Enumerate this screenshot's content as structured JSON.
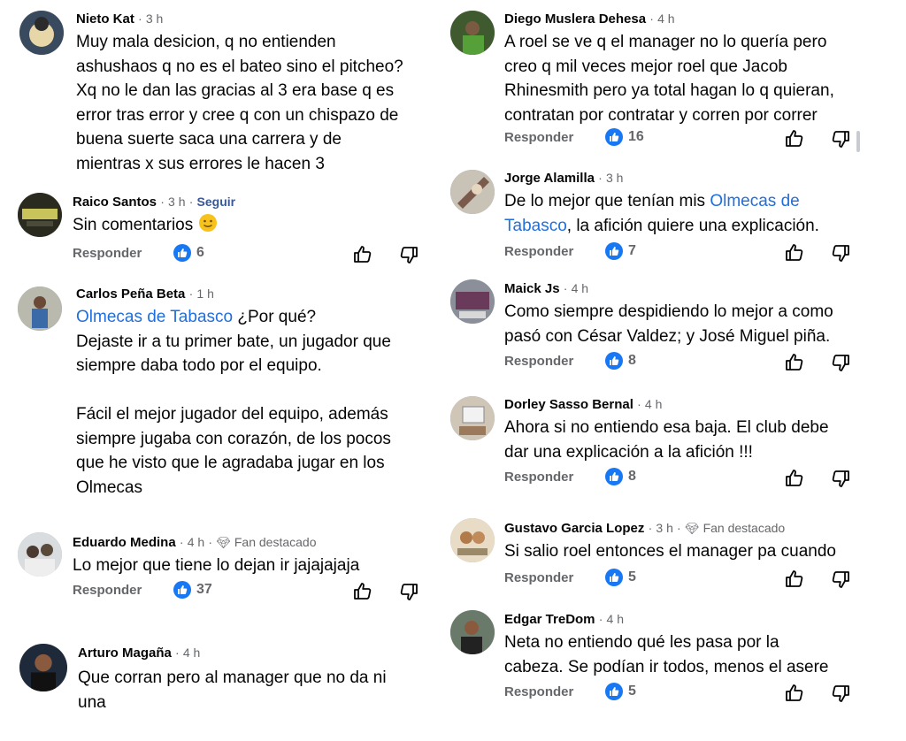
{
  "ui": {
    "reply_label": "Responder",
    "follow_label": "Seguir",
    "fan_label": "Fan destacado",
    "separator": "·"
  },
  "comments_left": [
    {
      "author": "Nieto Kat",
      "time": "3 h",
      "text": "Muy mala desicion, q no entienden\nashushaos q no es el bateo sino el pitcheo?\nXq no le dan las gracias al 3 era base q es\nerror tras error y cree q con un chispazo de\nbuena suerte saca una carrera y de\nmientras x sus errores le hacen 3"
    },
    {
      "author": "Raico Santos",
      "time": "3 h",
      "text": "Sin comentarios",
      "emoji": "slightly-smiling-face",
      "likes": "6"
    },
    {
      "author": "Carlos Peña Beta",
      "time": "1 h",
      "mention": "Olmecas de Tabasco",
      "text_after_mention": " ¿Por qué?",
      "text": "Dejaste ir a tu primer bate, un jugador que\nsiempre daba todo por el equipo.\n\nFácil el mejor jugador del equipo, además\nsiempre jugaba con corazón, de los pocos\nque he visto que le agradaba jugar en los\nOlmecas"
    },
    {
      "author": "Eduardo Medina",
      "time": "4 h",
      "text": "Lo mejor que tiene lo dejan ir jajajajaja",
      "likes": "37"
    },
    {
      "author": "Arturo Magaña",
      "time": "4 h",
      "text": "Que corran pero al manager que no da ni\nuna"
    }
  ],
  "comments_right": [
    {
      "author": "Diego Muslera Dehesa",
      "time": "4 h",
      "text": "A roel se ve q el manager no lo quería pero\ncreo q mil veces mejor roel que Jacob\nRhinesmith pero ya total hagan lo q quieran,\ncontratan por contratar y corren por correr",
      "likes": "16"
    },
    {
      "author": "Jorge Alamilla",
      "time": "3 h",
      "text_before_mention": "De lo mejor que tenían mis ",
      "mention_line1": "Olmecas de",
      "mention_line2": "Tabasco",
      "text_after_mention": ", la afición quiere una explicación.",
      "likes": "7"
    },
    {
      "author": "Maick Js",
      "time": "4 h",
      "text": "Como siempre despidiendo lo mejor a como\npasó con César Valdez; y José Miguel piña.",
      "likes": "8"
    },
    {
      "author": "Dorley Sasso Bernal",
      "time": "4 h",
      "text": "Ahora si no entiendo esa baja. El club debe\ndar una explicación a la afición !!!",
      "likes": "8"
    },
    {
      "author": "Gustavo Garcia Lopez",
      "time": "3 h",
      "text": "Si salio roel entonces el manager pa cuando",
      "likes": "5"
    },
    {
      "author": "Edgar TreDom",
      "time": "4 h",
      "text": "Neta no entiendo qué les pasa por la\ncabeza. Se podían ir todos, menos el asere",
      "likes": "5"
    }
  ],
  "colors": {
    "link": "#216fdb",
    "like_badge": "#1877f2",
    "muted": "#65676b",
    "follow": "#385898"
  }
}
